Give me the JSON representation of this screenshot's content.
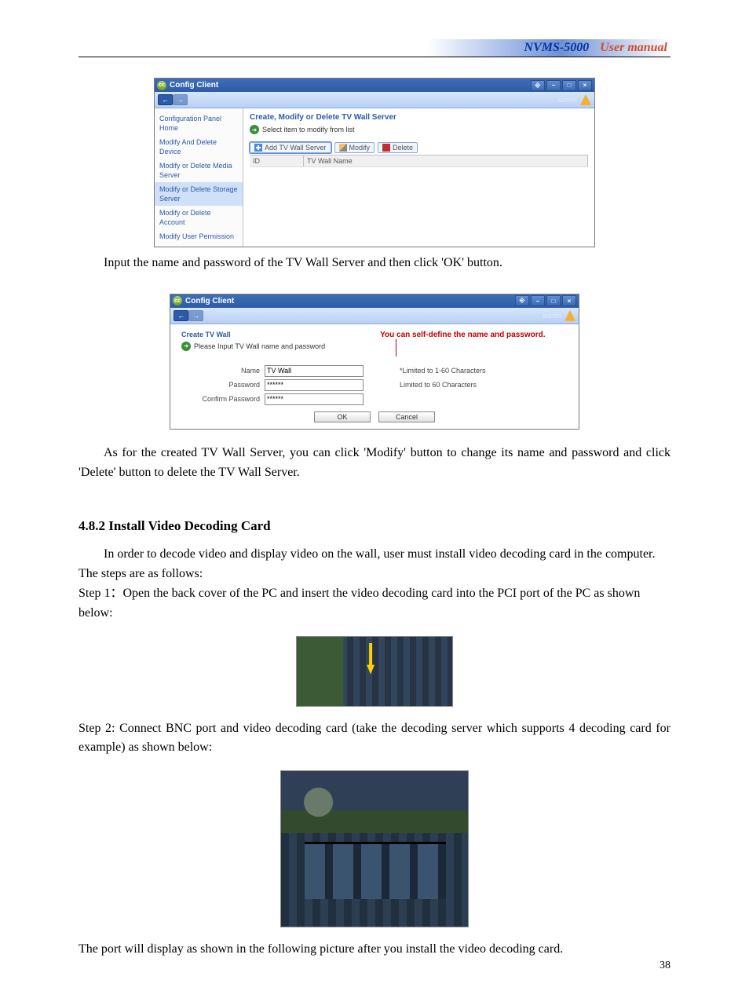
{
  "header": {
    "product": "NVMS-5000",
    "manual": "User manual"
  },
  "window1": {
    "title": "Config Client",
    "admin": "admin",
    "nav_back": "←",
    "nav_fwd": "→",
    "sidebar": {
      "items": [
        "Configuration Panel Home",
        "Modify And Delete Device",
        "Modify or Delete Media Server",
        "Modify or Delete Storage Server",
        "Modify or Delete Account",
        "Modify User Permission"
      ]
    },
    "content": {
      "title": "Create,  Modify or Delete TV Wall Server",
      "hint": "Select item to modify from list",
      "buttons": {
        "add": "Add TV Wall Server",
        "modify": "Modify",
        "delete": "Delete"
      },
      "columns": {
        "id": "ID",
        "name": "TV Wall Name"
      }
    }
  },
  "between1": "Input the name and password of the TV Wall Server and then click 'OK' button.",
  "window2": {
    "title": "Config Client",
    "admin": "admin",
    "section_title": "Create TV Wall",
    "hint": "Please Input TV Wall name and password",
    "callout": "You can self-define the name and password.",
    "labels": {
      "name": "Name",
      "password": "Password",
      "confirm": "Confirm Password"
    },
    "values": {
      "name": "TV Wall",
      "password": "******",
      "confirm": "******"
    },
    "hints": {
      "name_hint": "*Limited to 1-60 Characters",
      "pwd_hint": "Limited to 60 Characters"
    },
    "buttons": {
      "ok": "OK",
      "cancel": "Cancel"
    }
  },
  "para_modify_delete": "As for the created TV Wall Server, you can click 'Modify' button to change its name and password and click 'Delete' button to delete the TV Wall Server.",
  "section": "4.8.2 Install Video Decoding Card",
  "para_intro": "In order to decode video and display video on the wall, user must install video decoding card in the computer.",
  "para_steps_intro": "The steps are as follows:",
  "step1": "Step 1：Open the back cover of the PC and insert the video decoding card into the PCI port of the PC as shown below:",
  "step2": "Step 2: Connect BNC port and video decoding card (take the decoding server which supports 4 decoding card for example) as shown below:",
  "para_port_display": "The port will display as shown in the following picture after you install the video decoding card.",
  "page_number": "38"
}
